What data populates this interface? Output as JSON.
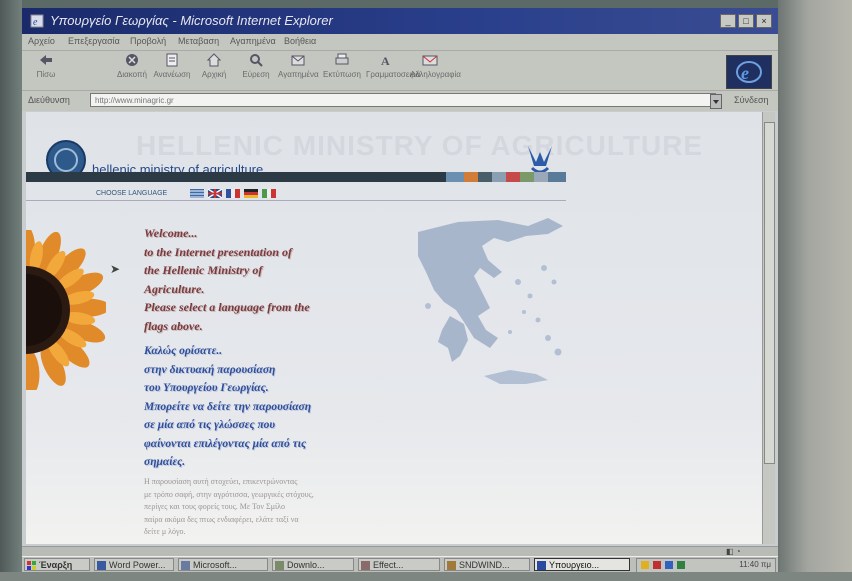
{
  "window": {
    "title": "Υπουργείο Γεωργίας - Microsoft Internet Explorer"
  },
  "menubar": {
    "items": [
      "Αρχείο",
      "Επεξεργασία",
      "Προβολή",
      "Μεταβαση",
      "Αγαπημένα",
      "Βοήθεια"
    ]
  },
  "toolbar": {
    "buttons": [
      {
        "label": "Πίσω",
        "icon": "back-arrow-icon"
      },
      {
        "label": "Διακοπή",
        "icon": "stop-icon"
      },
      {
        "label": "Ανανέωση",
        "icon": "refresh-icon"
      },
      {
        "label": "Αρχική",
        "icon": "home-icon"
      },
      {
        "label": "Εύρεση",
        "icon": "search-icon"
      },
      {
        "label": "Αγαπημένα",
        "icon": "favorites-icon"
      },
      {
        "label": "Εκτύπωση",
        "icon": "print-icon"
      },
      {
        "label": "Γραμματοσειρά",
        "icon": "font-icon"
      },
      {
        "label": "Αλληλογραφία",
        "icon": "mail-icon"
      }
    ]
  },
  "address": {
    "label": "Διεύθυνση",
    "url": "http://www.minagric.gr",
    "go_label": "Σύνδεση"
  },
  "page": {
    "ministry_name": "hellenic ministry of agriculture",
    "watermark": "HELLENIC MINISTRY OF AGRICULTURE",
    "choose_language": "CHOOSE LANGUAGE",
    "welcome_en": [
      "Welcome...",
      "to the Internet presentation of",
      "the Hellenic Ministry of",
      "Agriculture.",
      "Please select a language from the",
      "flags above."
    ],
    "welcome_gr": [
      "Καλώς ορίσατε..",
      "στην δικτυακή παρουσίαση",
      "του Υπουργείου Γεωργίας.",
      "Μπορείτε να δείτε την παρουσίαση",
      "σε μία από τις γλώσσες που",
      "φαίνονται επιλέγοντας μία από τις",
      "σημαίες."
    ],
    "body_text": [
      "Η παρουσίαση αυτή στοχεύει, επικεντρώνοντας",
      "με τρόπο σαφή, στην αγρότισσα, γεωργικές στόχους,",
      "περίγες και τους φορείς τους. Με Τον Σμίλο",
      "παίρα ακόμα δες πτως ενδιαφέρει, ελάτε ταξί να",
      "δείτε μ λόγο."
    ]
  },
  "taskbar": {
    "start_label": "Έναρξη",
    "tasks": [
      "Word Power...",
      "Microsoft...",
      "Downlo...",
      "Effect...",
      "SNDWIND...",
      "Υπουργειο..."
    ],
    "clock": "11:40 πμ"
  },
  "colors": {
    "title_bar": "#1a2a6a",
    "ministry_blue": "#23488a",
    "welcome_en": "#7a3a3e",
    "welcome_gr": "#2e4e98",
    "map_blue": "#a8b6cc"
  }
}
